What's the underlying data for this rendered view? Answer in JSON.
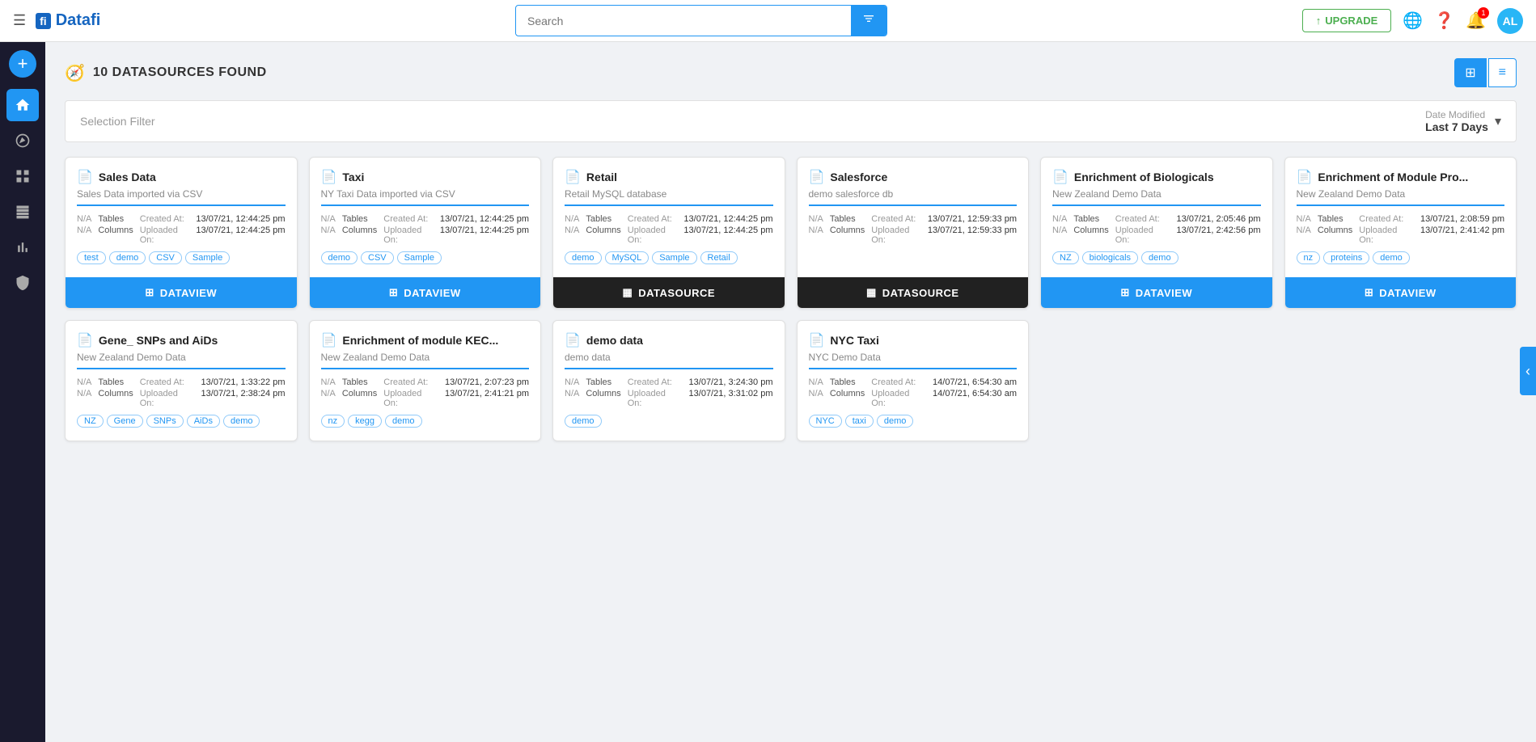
{
  "topnav": {
    "logo_icon": "fi",
    "logo_text": "Datafi",
    "search_placeholder": "Search",
    "upgrade_label": "UPGRADE",
    "notif_count": "1",
    "avatar_initials": "AL"
  },
  "page": {
    "title": "10 DATASOURCES FOUND",
    "date_filter_label": "Date Modified",
    "date_filter_value": "Last 7 Days",
    "selection_filter_placeholder": "Selection Filter"
  },
  "view_toggle": {
    "grid_icon": "⊞",
    "list_icon": "≡"
  },
  "cards": [
    {
      "title": "Sales Data",
      "subtitle": "Sales Data imported via CSV",
      "tables": "N/A",
      "columns": "N/A",
      "created_at": "13/07/21, 12:44:25 pm",
      "uploaded_on": "13/07/21, 12:44:25 pm",
      "tags": [
        "test",
        "demo",
        "CSV",
        "Sample"
      ],
      "btn_type": "dataview",
      "btn_label": "DATAVIEW"
    },
    {
      "title": "Taxi",
      "subtitle": "NY Taxi Data imported via CSV",
      "tables": "N/A",
      "columns": "N/A",
      "created_at": "13/07/21, 12:44:25 pm",
      "uploaded_on": "13/07/21, 12:44:25 pm",
      "tags": [
        "demo",
        "CSV",
        "Sample"
      ],
      "btn_type": "dataview",
      "btn_label": "DATAVIEW"
    },
    {
      "title": "Retail",
      "subtitle": "Retail MySQL database",
      "tables": "N/A",
      "columns": "N/A",
      "created_at": "13/07/21, 12:44:25 pm",
      "uploaded_on": "13/07/21, 12:44:25 pm",
      "tags": [
        "demo",
        "MySQL",
        "Sample",
        "Retail"
      ],
      "btn_type": "datasource",
      "btn_label": "DATASOURCE"
    },
    {
      "title": "Salesforce",
      "subtitle": "demo salesforce db",
      "tables": "N/A",
      "columns": "N/A",
      "created_at": "13/07/21, 12:59:33 pm",
      "uploaded_on": "13/07/21, 12:59:33 pm",
      "tags": [],
      "btn_type": "datasource",
      "btn_label": "DATASOURCE"
    },
    {
      "title": "Enrichment of Biologicals",
      "subtitle": "New Zealand Demo Data",
      "tables": "N/A",
      "columns": "N/A",
      "created_at": "13/07/21, 2:05:46 pm",
      "uploaded_on": "13/07/21, 2:42:56 pm",
      "tags": [
        "NZ",
        "biologicals",
        "demo"
      ],
      "btn_type": "dataview",
      "btn_label": "DATAVIEW"
    },
    {
      "title": "Enrichment of Module Pro...",
      "subtitle": "New Zealand Demo Data",
      "tables": "N/A",
      "columns": "N/A",
      "created_at": "13/07/21, 2:08:59 pm",
      "uploaded_on": "13/07/21, 2:41:42 pm",
      "tags": [
        "nz",
        "proteins",
        "demo"
      ],
      "btn_type": "dataview",
      "btn_label": "DATAVIEW"
    },
    {
      "title": "Gene_ SNPs and AiDs",
      "subtitle": "New Zealand Demo Data",
      "tables": "N/A",
      "columns": "N/A",
      "created_at": "13/07/21, 1:33:22 pm",
      "uploaded_on": "13/07/21, 2:38:24 pm",
      "tags": [
        "NZ",
        "Gene",
        "SNPs",
        "AiDs",
        "demo"
      ],
      "btn_type": null,
      "btn_label": null
    },
    {
      "title": "Enrichment of module KEC...",
      "subtitle": "New Zealand Demo Data",
      "tables": "N/A",
      "columns": "N/A",
      "created_at": "13/07/21, 2:07:23 pm",
      "uploaded_on": "13/07/21, 2:41:21 pm",
      "tags": [
        "nz",
        "kegg",
        "demo"
      ],
      "btn_type": null,
      "btn_label": null
    },
    {
      "title": "demo data",
      "subtitle": "demo data",
      "tables": "N/A",
      "columns": "N/A",
      "created_at": "13/07/21, 3:24:30 pm",
      "uploaded_on": "13/07/21, 3:31:02 pm",
      "tags": [
        "demo"
      ],
      "btn_type": null,
      "btn_label": null
    },
    {
      "title": "NYC Taxi",
      "subtitle": "NYC Demo Data",
      "tables": "N/A",
      "columns": "N/A",
      "created_at": "14/07/21, 6:54:30 am",
      "uploaded_on": "14/07/21, 6:54:30 am",
      "tags": [
        "NYC",
        "taxi",
        "demo"
      ],
      "btn_type": null,
      "btn_label": null
    }
  ],
  "sidebar": {
    "items": [
      {
        "name": "home",
        "icon": "🏠"
      },
      {
        "name": "compass",
        "icon": "🧭"
      },
      {
        "name": "grid",
        "icon": "⊞"
      },
      {
        "name": "table",
        "icon": "▦"
      },
      {
        "name": "chart",
        "icon": "📊"
      },
      {
        "name": "shield",
        "icon": "🛡"
      }
    ]
  }
}
